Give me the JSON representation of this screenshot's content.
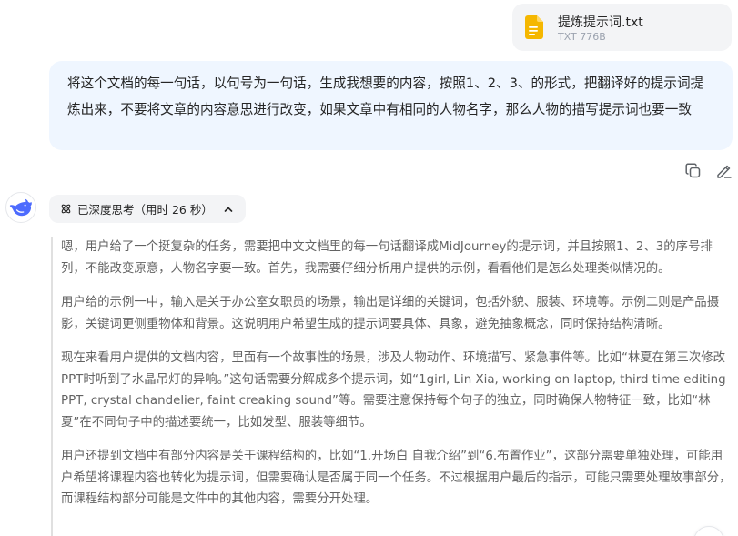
{
  "file": {
    "name": "提炼提示词.txt",
    "meta": "TXT 776B",
    "icon": "document-icon",
    "icon_color": "#f5b700"
  },
  "user_message": "将这个文档的每一句话，以句号为一句话，生成我想要的内容，按照1、2、3、的形式，把翻译好的提示词提炼出来，不要将文章的内容意思进行改变，如果文章中有相同的人物名字，那么人物的描写提示词也要一致",
  "actions": {
    "copy_icon": "copy-icon",
    "edit_icon": "edit-icon"
  },
  "assistant": {
    "avatar_icon": "whale-icon",
    "brand_color": "#4d6bfe",
    "thinking_label": "已深度思考（用时 26 秒）",
    "thinking_paragraphs": [
      "嗯，用户给了一个挺复杂的任务，需要把中文文档里的每一句话翻译成MidJourney的提示词，并且按照1、2、3的序号排列，不能改变原意，人物名字要一致。首先，我需要仔细分析用户提供的示例，看看他们是怎么处理类似情况的。",
      "用户给的示例一中，输入是关于办公室女职员的场景，输出是详细的关键词，包括外貌、服装、环境等。示例二则是产品摄影，关键词更侧重物体和背景。这说明用户希望生成的提示词要具体、具象，避免抽象概念，同时保持结构清晰。",
      "现在来看用户提供的文档内容，里面有一个故事性的场景，涉及人物动作、环境描写、紧急事件等。比如“林夏在第三次修改PPT时听到了水晶吊灯的异响。”这句话需要分解成多个提示词，如“1girl, Lin Xia, working on laptop, third time editing PPT, crystal chandelier, faint creaking sound”等。需要注意保持每个句子的独立，同时确保人物特征一致，比如“林夏”在不同句子中的描述要统一，比如发型、服装等细节。",
      "用户还提到文档中有部分内容是关于课程结构的，比如“1.开场白 自我介绍”到“6.布置作业”，这部分需要单独处理，可能用户希望将课程内容也转化为提示词，但需要确认是否属于同一个任务。不过根据用户最后的指示，可能只需要处理故事部分，而课程结构部分可能是文件中的其他内容，需要分开处理。"
    ]
  }
}
